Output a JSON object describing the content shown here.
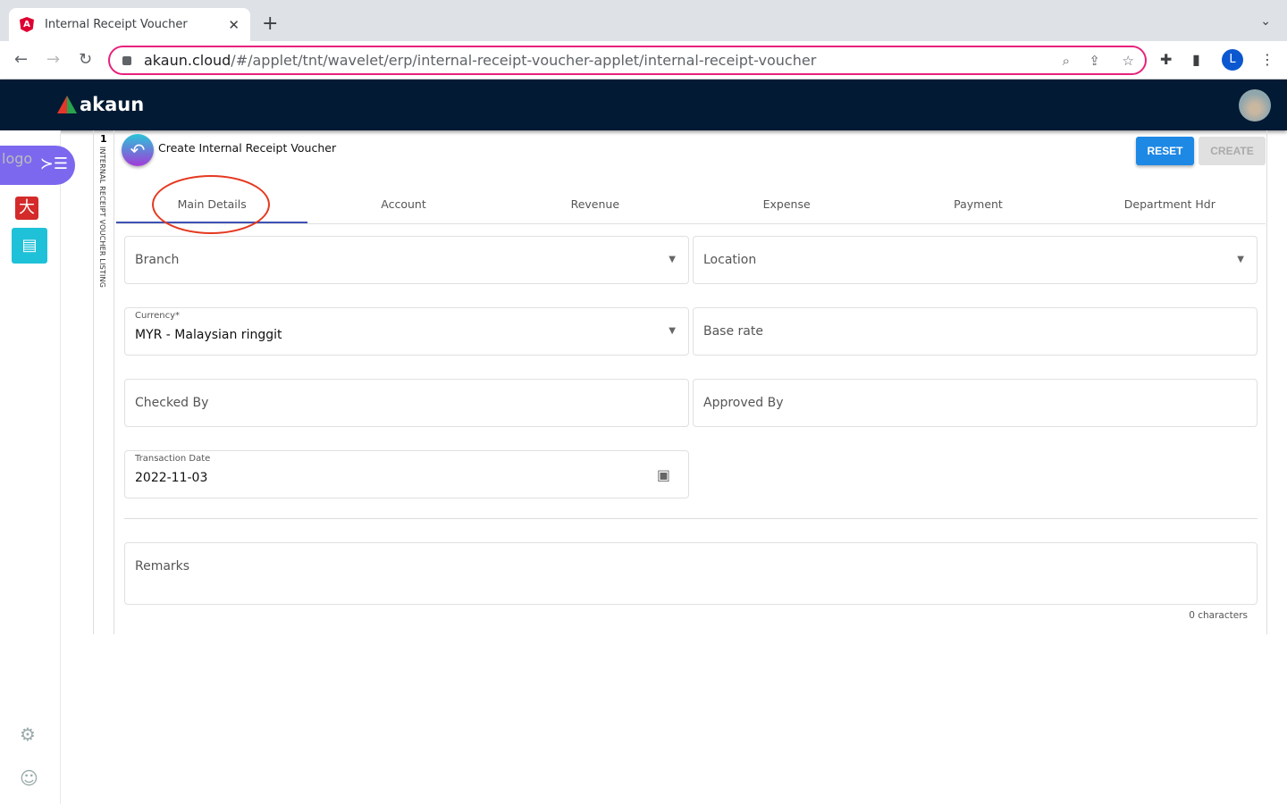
{
  "browser": {
    "tab_title": "Internal Receipt Voucher",
    "url_host": "akaun.cloud",
    "url_path": "/#/applet/tnt/wavelet/erp/internal-receipt-voucher-applet/internal-receipt-voucher",
    "profile_initial": "L"
  },
  "app": {
    "brand": "akaun",
    "logo_alt": "logo"
  },
  "listing": {
    "count": "1",
    "label": "INTERNAL RECEIPT VOUCHER LISTING"
  },
  "page": {
    "title": "Create Internal Receipt Voucher",
    "reset_label": "RESET",
    "create_label": "CREATE"
  },
  "tabs": [
    {
      "label": "Main Details"
    },
    {
      "label": "Account"
    },
    {
      "label": "Revenue"
    },
    {
      "label": "Expense"
    },
    {
      "label": "Payment"
    },
    {
      "label": "Department Hdr"
    }
  ],
  "form": {
    "branch": "Branch",
    "location": "Location",
    "currency_label": "Currency*",
    "currency_value": "MYR - Malaysian ringgit",
    "base_rate": "Base rate",
    "checked_by": "Checked By",
    "approved_by": "Approved By",
    "date_label": "Transaction Date",
    "date_value": "2022-11-03",
    "remarks": "Remarks",
    "char_count": "0 characters"
  },
  "colors": {
    "header": "#021a33",
    "accent": "#1e88e5",
    "annotation": "#e53920"
  }
}
